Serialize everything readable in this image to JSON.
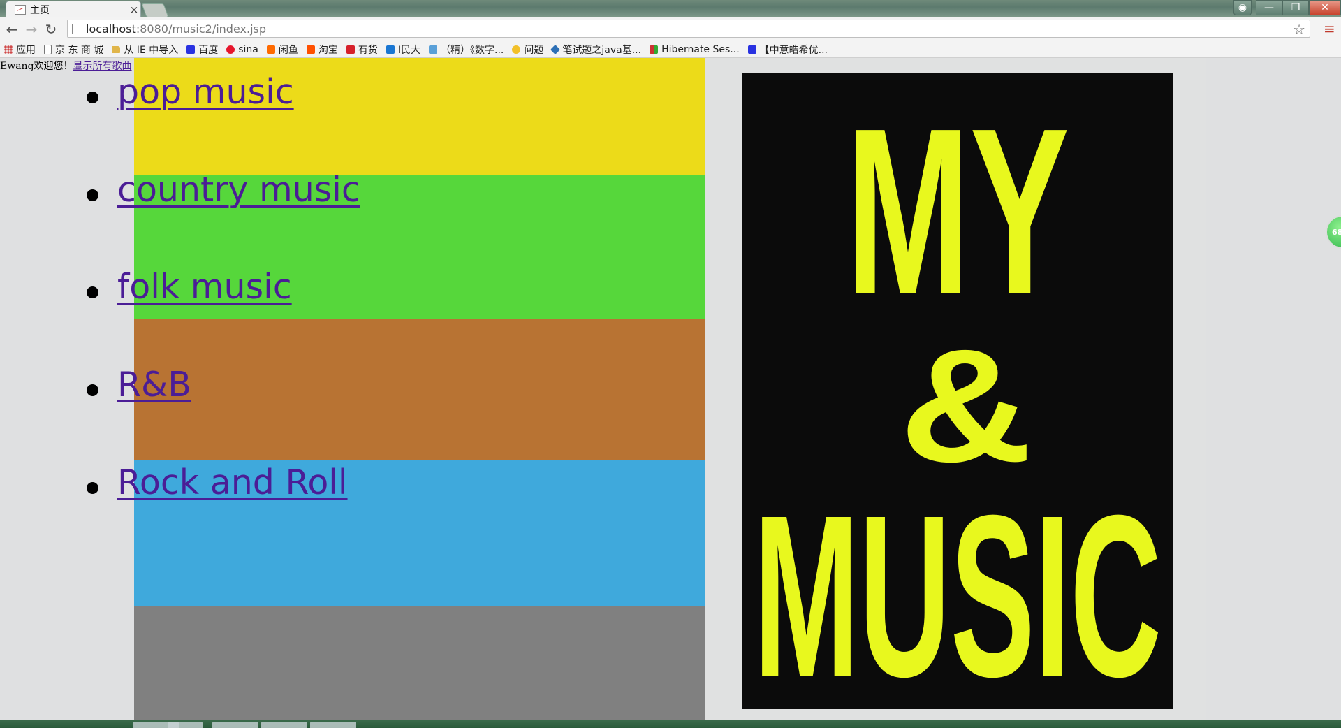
{
  "browser": {
    "tab_title": "主页",
    "tab_close": "×",
    "url_host": "localhost",
    "url_rest": ":8080/music2/index.jsp",
    "window_buttons": {
      "minimize": "—",
      "maximize": "❐",
      "close": "✕"
    }
  },
  "bookmarks": [
    {
      "label": "应用",
      "icon": "apps-grid-icon"
    },
    {
      "label": "京 东 商 城",
      "icon": "page-icon"
    },
    {
      "label": "从 IE 中导入",
      "icon": "folder-icon"
    },
    {
      "label": "百度",
      "icon": "baidu-paw-icon"
    },
    {
      "label": "sina",
      "icon": "weibo-icon"
    },
    {
      "label": "闲鱼",
      "icon": "xianyu-icon"
    },
    {
      "label": "淘宝",
      "icon": "taobao-icon"
    },
    {
      "label": "有货",
      "icon": "yohobuy-icon"
    },
    {
      "label": "I民大",
      "icon": "info-icon"
    },
    {
      "label": "（精）《数字...",
      "icon": "book-icon"
    },
    {
      "label": "问题",
      "icon": "question-icon"
    },
    {
      "label": "笔试题之java基...",
      "icon": "diamond-icon"
    },
    {
      "label": "Hibernate Ses...",
      "icon": "hibernate-icon"
    },
    {
      "label": "【中意皓希优...",
      "icon": "baidu-paw-icon"
    }
  ],
  "page": {
    "greeting": "Ewang欢迎您！",
    "show_all_link": "显示所有歌曲",
    "genres": [
      "pop music",
      "country music",
      "folk music",
      "R&B",
      "Rock and Roll"
    ],
    "poster_line1": "MY",
    "poster_line2": "&",
    "poster_line3": "MUSIC",
    "float_badge": "68"
  },
  "colors": {
    "stripe_yellow": "#ecdb19",
    "stripe_green": "#56d73b",
    "stripe_brown": "#b87333",
    "stripe_blue": "#3fa9dc",
    "stripe_gray": "#808080",
    "poster_bg": "#0b0b0b",
    "poster_text": "#e8f81e",
    "link": "#4b1d96"
  }
}
